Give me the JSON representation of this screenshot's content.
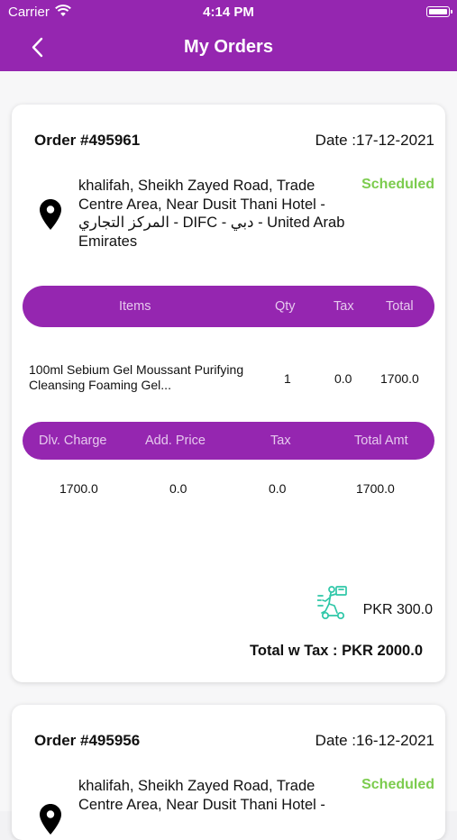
{
  "status_bar": {
    "carrier": "Carrier",
    "time": "4:14 PM"
  },
  "navbar": {
    "title": "My Orders",
    "back_icon": "chevron-left-icon"
  },
  "colors": {
    "brand": "#9526b0",
    "scheduled": "#7ccc4e",
    "scooter": "#2ec7a8"
  },
  "orders": [
    {
      "number": "Order #495961",
      "date": "Date :17-12-2021",
      "address": "khalifah, Sheikh Zayed Road, Trade Centre Area, Near Dusit Thani Hotel - المركز التجاري - DIFC - دبي - United Arab Emirates",
      "status": "Scheduled",
      "items_header": {
        "items": "Items",
        "qty": "Qty",
        "tax": "Tax",
        "total": "Total"
      },
      "items": [
        {
          "name": "100ml Sebium Gel Moussant Purifying Cleansing Foaming Gel...",
          "qty": "1",
          "tax": "0.0",
          "total": "1700.0"
        }
      ],
      "charges_header": {
        "delivery": "Dlv. Charge",
        "additional": "Add. Price",
        "tax": "Tax",
        "total": "Total Amt"
      },
      "charges": {
        "delivery": "1700.0",
        "additional": "0.0",
        "tax": "0.0",
        "total": "1700.0"
      },
      "delivery_price": "PKR 300.0",
      "total_with_tax": "Total w Tax : PKR 2000.0"
    },
    {
      "number": "Order #495956",
      "date": "Date :16-12-2021",
      "address": "khalifah, Sheikh Zayed Road, Trade Centre Area, Near Dusit Thani Hotel -",
      "status": "Scheduled"
    }
  ]
}
